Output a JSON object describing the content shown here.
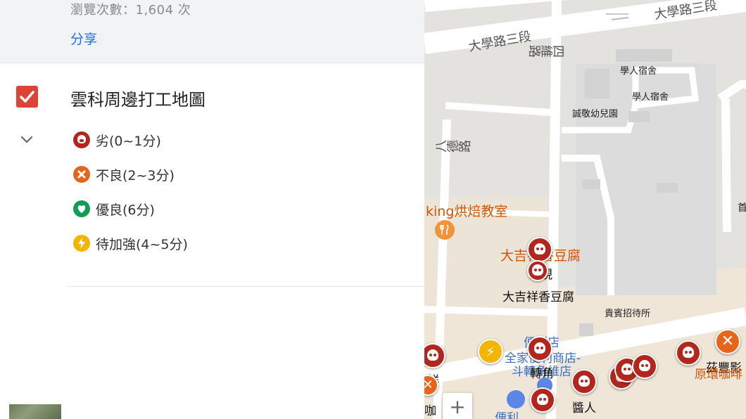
{
  "panel": {
    "views_text": "瀏覽次數：1,604 次",
    "share_label": "分享",
    "layer": {
      "title": "雲科周邊打工地圖",
      "checked": true,
      "check_color": "#db4437"
    },
    "legend": [
      {
        "label": "劣(0~1分)",
        "icon": "skull-icon",
        "color": "#b3261e"
      },
      {
        "label": "不良(2~3分)",
        "icon": "x-icon",
        "color": "#e8641b"
      },
      {
        "label": "優良(6分)",
        "icon": "heart-icon",
        "color": "#0f9d58"
      },
      {
        "label": "待加強(4~5分)",
        "icon": "bolt-icon",
        "color": "#f5b400"
      }
    ]
  },
  "map": {
    "roads": {
      "road_top_a": "大學路三段",
      "road_top_b": "大學路三段",
      "road_vertical_a": "四維路",
      "road_vertical_b": "八德路"
    },
    "places": {
      "dorm_1": "學人宿舍",
      "dorm_2": "學人宿舍",
      "kindergarten": "誠敬幼兒園",
      "guesthouse": "貴賓招待所",
      "bakery": "king烘焙教室",
      "tofu_orange": "大吉祥香豆腐",
      "tofu_label": "大吉祥香豆腐",
      "marker_label_1": "常現",
      "store_1": "便利店",
      "store_2": "全家便利商店-",
      "store_3": "斗轉角維店",
      "marker_label_2": "轉角",
      "marker_label_3": "鮮",
      "marker_label_4": "醬人",
      "marker_label_5": "茲豐影",
      "marker_label_6": "原環咖啡",
      "bottom_cut": "便利",
      "edge_char": "首",
      "left_edge": "咖"
    },
    "zoom_in_label": "+"
  }
}
